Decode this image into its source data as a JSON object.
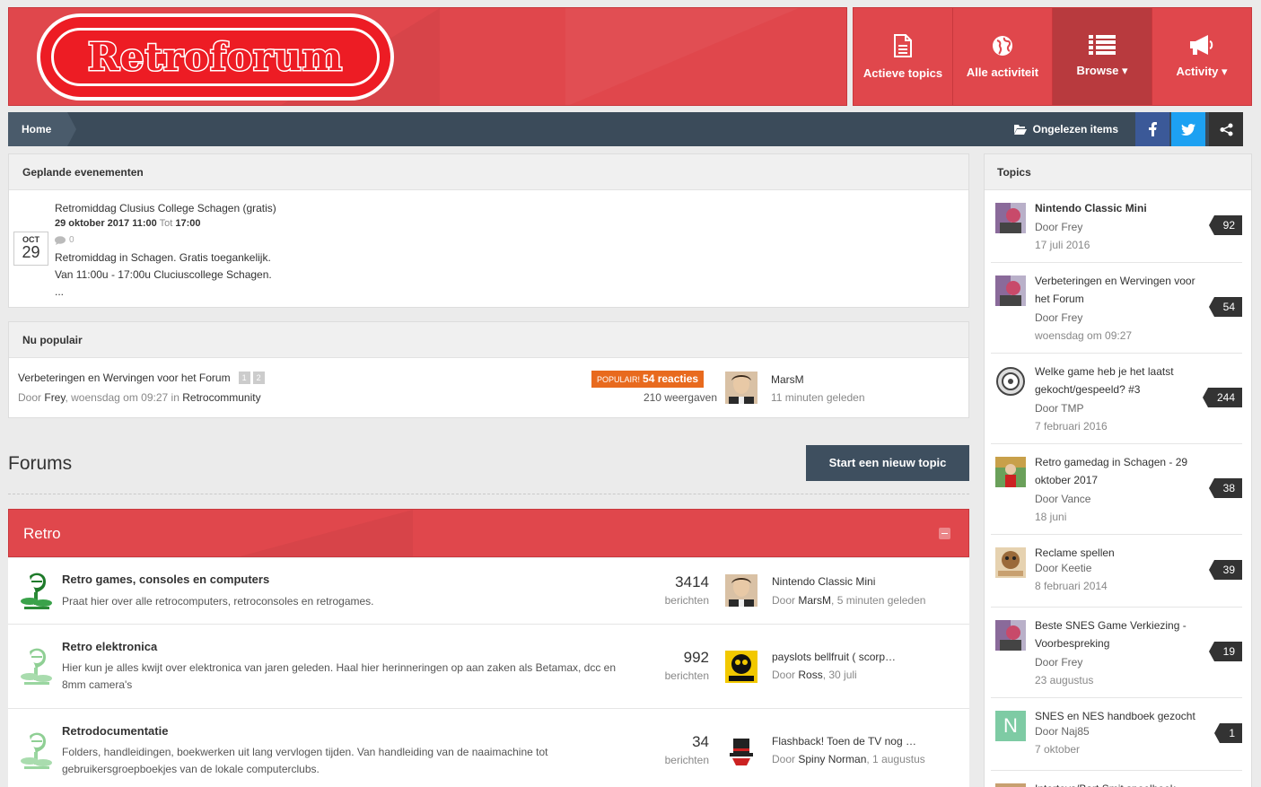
{
  "header": {
    "logo_text": "Retroforum",
    "nav": [
      {
        "label": "Actieve topics",
        "icon": "document-icon"
      },
      {
        "label": "Alle activiteit",
        "icon": "globe-icon"
      },
      {
        "label": "Browse ▾",
        "icon": "list-icon"
      },
      {
        "label": "Activity ▾",
        "icon": "megaphone-icon"
      }
    ]
  },
  "breadcrumb": {
    "home": "Home",
    "unread": "Ongelezen items"
  },
  "events": {
    "title": "Geplande evenementen",
    "month": "OCT",
    "day": "29",
    "event_title": "Retromiddag Clusius College Schagen (gratis)",
    "date_start": "29 oktober 2017 11:00",
    "date_sep": "Tot",
    "date_end": "17:00",
    "comments": "0",
    "desc_1": "Retromiddag in Schagen. Gratis toegankelijk.",
    "desc_2": "Van 11:00u - 17:00u Cluciuscollege Schagen.",
    "desc_3": "..."
  },
  "popular": {
    "title": "Nu populair",
    "topic": "Verbeteringen en Wervingen voor het Forum",
    "pages": [
      "1",
      "2"
    ],
    "by": "Door",
    "author": "Frey",
    "when": ", woensdag om 09:27 in",
    "forum": "Retrocommunity",
    "badge_label": "POPULAIR!",
    "badge_count": "54 reacties",
    "views": "210 weergaven",
    "last_user": "MarsM",
    "last_time": "11 minuten geleden"
  },
  "forums": {
    "heading": "Forums",
    "new_topic": "Start een nieuw topic",
    "category": "Retro",
    "rows": [
      {
        "title": "Retro games, consoles en computers",
        "desc": "Praat hier over alle retrocomputers, retroconsoles en retrogames.",
        "count": "3414",
        "count_label": "berichten",
        "last_title": "Nintendo Classic Mini",
        "last_by": "Door",
        "last_user": "MarsM",
        "last_time": ", 5 minuten geleden"
      },
      {
        "title": "Retro elektronica",
        "desc": "Hier kun je alles kwijt over elektronica van jaren geleden. Haal hier herinneringen op aan zaken als Betamax, dcc en 8mm camera's",
        "count": "992",
        "count_label": "berichten",
        "last_title": "payslots bellfruit ( scorp…",
        "last_by": "Door",
        "last_user": "Ross",
        "last_time": ", 30 juli"
      },
      {
        "title": "Retrodocumentatie",
        "desc": "Folders, handleidingen, boekwerken uit lang vervlogen tijden. Van handleiding van de naaimachine tot gebruikersgroepboekjes van de lokale computerclubs.",
        "count": "34",
        "count_label": "berichten",
        "last_title": "Flashback! Toen de TV nog …",
        "last_by": "Door",
        "last_user": "Spiny Norman",
        "last_time": ", 1 augustus"
      }
    ]
  },
  "topics": {
    "title": "Topics",
    "items": [
      {
        "title": "Nintendo Classic Mini",
        "by": "Door Frey",
        "date": "17 juli 2016",
        "count": "92"
      },
      {
        "title": "Verbeteringen en Wervingen voor het Forum",
        "by": "Door Frey",
        "date": "woensdag om 09:27",
        "count": "54"
      },
      {
        "title": "Welke game heb je het laatst gekocht/gespeeld? #3",
        "by": "Door TMP",
        "date": "7 februari 2016",
        "count": "244"
      },
      {
        "title": "Retro gamedag in Schagen - 29 oktober 2017",
        "by": "Door Vance",
        "date": "18 juni",
        "count": "38"
      },
      {
        "title": "Reclame spellen",
        "by": "Door Keetie",
        "date": "8 februari 2014",
        "count": "39"
      },
      {
        "title": "Beste SNES Game Verkiezing - Voorbespreking",
        "by": "Door Frey",
        "date": "23 augustus",
        "count": "19"
      },
      {
        "title": "SNES en NES handboek gezocht",
        "by": "Door Naj85",
        "date": "7 oktober",
        "count": "1",
        "avatar_letter": "N"
      },
      {
        "title": "Intertoys/Bart Smit spoelboek",
        "by": "",
        "date": "",
        "count": ""
      }
    ]
  },
  "colors": {
    "brand": "#e0474c",
    "bar": "#3b4b5a",
    "popular": "#e86a1e"
  }
}
